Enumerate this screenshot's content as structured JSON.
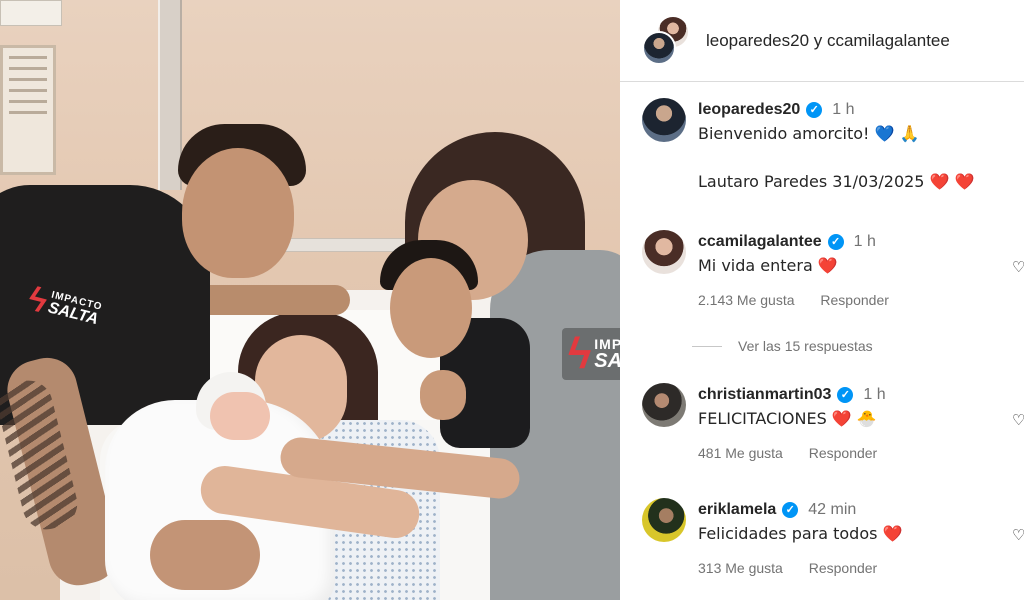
{
  "photo": {
    "watermark_small": {
      "line1": "IMPACTO",
      "line2": "SALTA"
    },
    "watermark_big": {
      "line1": "IMPACTO",
      "line2": "SALTA"
    }
  },
  "header": {
    "title": "leoparedes20 y ccamilagalantee"
  },
  "caption": {
    "username": "leoparedes20",
    "time": "1 h",
    "line1": "Bienvenido amorcito! 💙 🙏",
    "line2": "Lautaro Paredes 31/03/2025 ❤️ ❤️"
  },
  "comments": [
    {
      "username": "ccamilagalantee",
      "time": "1 h",
      "text": "Mi vida entera ❤️",
      "likes": "2.143 Me gusta",
      "reply_label": "Responder"
    },
    {
      "username": "christianmartin03",
      "time": "1 h",
      "text": "FELICITACIONES ❤️ 🐣",
      "likes": "481 Me gusta",
      "reply_label": "Responder"
    },
    {
      "username": "eriklamela",
      "time": "42 min",
      "text": "Felicidades para todos ❤️",
      "likes": "313 Me gusta",
      "reply_label": "Responder"
    }
  ],
  "view_replies": "Ver las 15 respuestas",
  "colors": {
    "verified": "#0095f6",
    "heart": "#e0244b",
    "muted_text": "#737373",
    "watermark_bolt": "#e23a3f"
  },
  "icons": {
    "verified": "verified-badge-icon",
    "like": "heart-outline-icon"
  }
}
